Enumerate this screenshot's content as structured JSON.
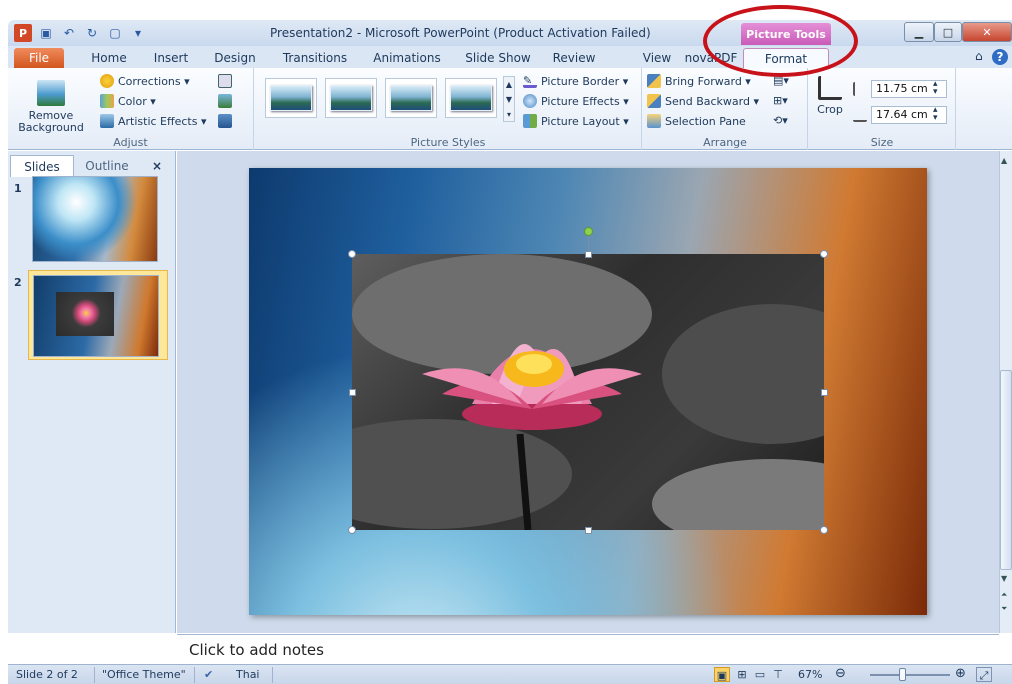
{
  "window": {
    "title": "Presentation2 - Microsoft PowerPoint (Product Activation Failed)",
    "context_tab_group": "Picture Tools",
    "app_icon": "powerpoint-icon"
  },
  "tabs": [
    {
      "label": "File"
    },
    {
      "label": "Home"
    },
    {
      "label": "Insert"
    },
    {
      "label": "Design"
    },
    {
      "label": "Transitions"
    },
    {
      "label": "Animations"
    },
    {
      "label": "Slide Show"
    },
    {
      "label": "Review"
    },
    {
      "label": "View"
    },
    {
      "label": "novaPDF"
    },
    {
      "label": "Format",
      "active": true
    }
  ],
  "ribbon": {
    "adjust": {
      "label": "Adjust",
      "remove_background": "Remove Background",
      "corrections": "Corrections ▾",
      "color": "Color ▾",
      "artistic_effects": "Artistic Effects ▾"
    },
    "picture_styles": {
      "label": "Picture Styles",
      "picture_border": "Picture Border ▾",
      "picture_effects": "Picture Effects ▾",
      "picture_layout": "Picture Layout ▾"
    },
    "arrange": {
      "label": "Arrange",
      "bring_forward": "Bring Forward ▾",
      "send_backward": "Send Backward ▾",
      "selection_pane": "Selection Pane"
    },
    "size": {
      "label": "Size",
      "crop": "Crop",
      "height": "11.75 cm",
      "width": "17.64 cm"
    }
  },
  "left_pane": {
    "tabs": [
      "Slides",
      "Outline"
    ],
    "close": "×",
    "slides": [
      {
        "number": "1"
      },
      {
        "number": "2",
        "selected": true
      }
    ]
  },
  "notes": {
    "placeholder": "Click to add notes"
  },
  "status": {
    "slide": "Slide 2 of 2",
    "theme": "\"Office Theme\"",
    "language": "Thai",
    "zoom": "67%",
    "zoom_fraction": 0.4
  },
  "colors": {
    "file_tab": "#d2561f",
    "context_tab": "#c95bb9",
    "annotation": "#c8121a",
    "rotate_handle": "#8fd14f"
  }
}
